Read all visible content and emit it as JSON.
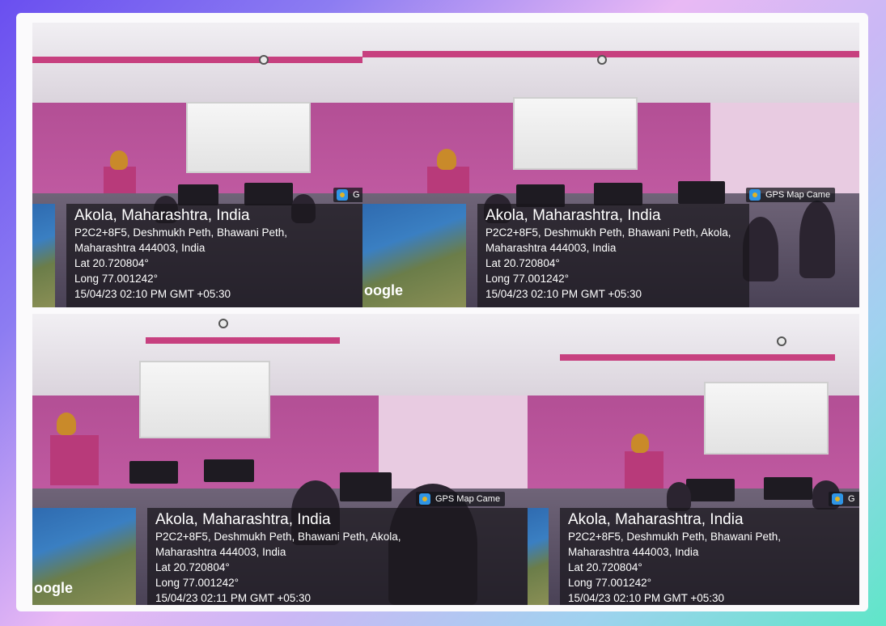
{
  "tiles": [
    {
      "location": "Akola, Maharashtra, India",
      "address_line1": "P2C2+8F5, Deshmukh Peth, Bhawani Peth,",
      "address_line2": "Maharashtra 444003, India",
      "lat": "Lat 20.720804°",
      "long": "Long 77.001242°",
      "datetime": "15/04/23 02:10 PM GMT +05:30",
      "badge": "G",
      "map_label": ""
    },
    {
      "location": "Akola, Maharashtra, India",
      "address_line1": "P2C2+8F5, Deshmukh Peth, Bhawani Peth, Akola,",
      "address_line2": "Maharashtra 444003, India",
      "lat": "Lat 20.720804°",
      "long": "Long 77.001242°",
      "datetime": "15/04/23 02:10 PM GMT +05:30",
      "badge": "GPS Map Came",
      "map_label": "oogle"
    },
    {
      "location": "Akola, Maharashtra, India",
      "address_line1": "P2C2+8F5, Deshmukh Peth, Bhawani Peth, Akola,",
      "address_line2": "Maharashtra 444003, India",
      "lat": "Lat 20.720804°",
      "long": "Long 77.001242°",
      "datetime": "15/04/23 02:11 PM GMT +05:30",
      "badge": "GPS Map Came",
      "map_label": "oogle"
    },
    {
      "location": "Akola, Maharashtra, India",
      "address_line1": "P2C2+8F5, Deshmukh Peth, Bhawani Peth,",
      "address_line2": "Maharashtra 444003, India",
      "lat": "Lat 20.720804°",
      "long": "Long 77.001242°",
      "datetime": "15/04/23 02:10 PM GMT +05:30",
      "badge": "G",
      "map_label": ""
    }
  ],
  "icons": {
    "camera": "gps-map-camera-icon",
    "map": "map-thumbnail"
  },
  "colors": {
    "wall": "#b34f95",
    "trim": "#c7407f",
    "overlay": "#19161c",
    "frame_start": "#6a4ff0",
    "frame_end": "#5fe6c8"
  }
}
